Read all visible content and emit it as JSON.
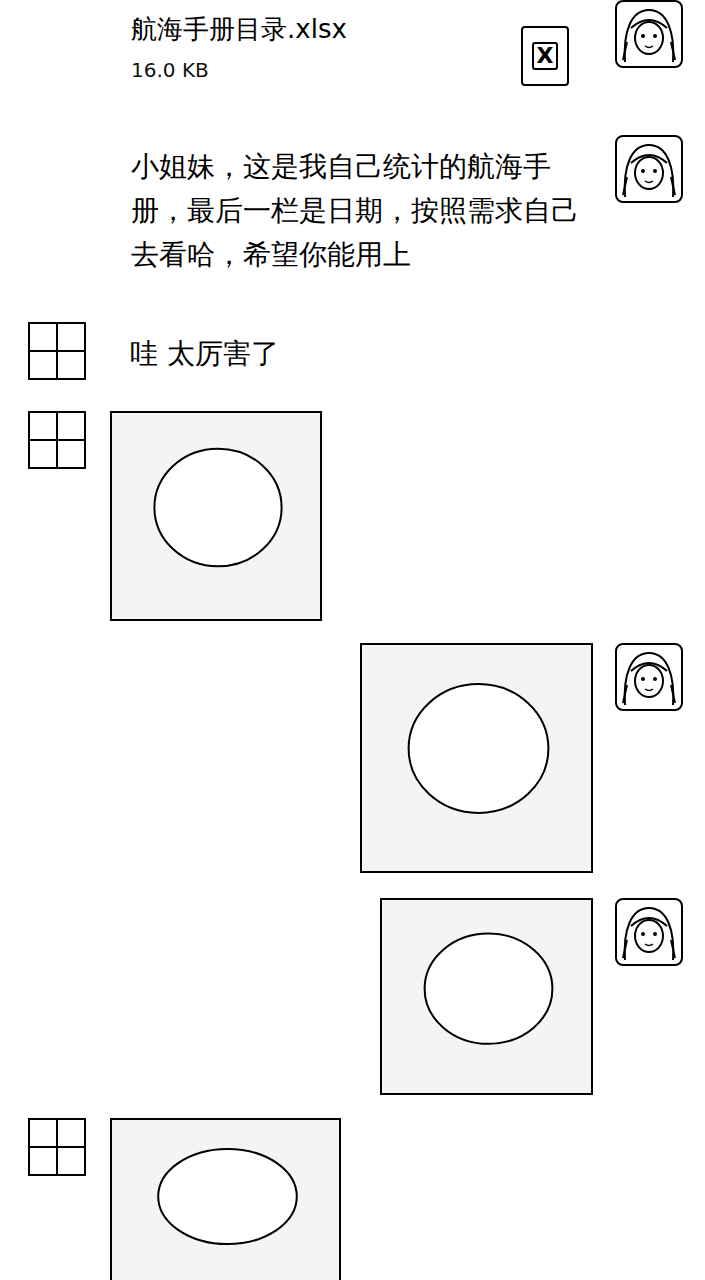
{
  "messages": [
    {
      "side": "right",
      "kind": "file",
      "file_name": "航海手册目录.xlsx",
      "file_size": "16.0 KB",
      "file_icon": "X"
    },
    {
      "side": "right",
      "kind": "text",
      "text": "小姐妹，这是我自己统计的航海手册，最后一栏是日期，按照需求自己去看哈，希望你能用上"
    },
    {
      "side": "left",
      "kind": "text",
      "text": "哇 太厉害了"
    },
    {
      "side": "left",
      "kind": "image"
    },
    {
      "side": "right",
      "kind": "image"
    },
    {
      "side": "right",
      "kind": "image"
    },
    {
      "side": "left",
      "kind": "image"
    }
  ]
}
